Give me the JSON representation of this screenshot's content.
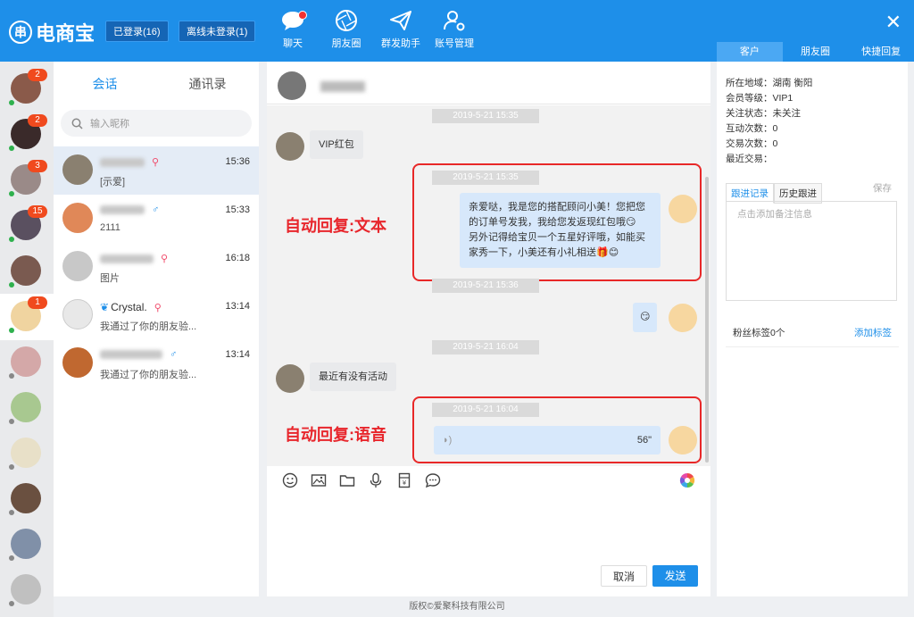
{
  "app": {
    "name": "电商宝"
  },
  "header": {
    "logged_in": "已登录(16)",
    "offline": "离线未登录(1)",
    "nav": [
      {
        "label": "聊天",
        "icon": "chat-icon"
      },
      {
        "label": "朋友圈",
        "icon": "aperture-icon"
      },
      {
        "label": "群发助手",
        "icon": "paper-plane-icon"
      },
      {
        "label": "账号管理",
        "icon": "user-gear-icon"
      }
    ],
    "right_tabs": [
      "客户",
      "朋友圈",
      "快捷回复"
    ],
    "close_symbol": "✕"
  },
  "avatars": [
    {
      "badge": "2",
      "online": "#2fb14e",
      "color": "#8a5a4a"
    },
    {
      "badge": "2",
      "online": "#2fb14e",
      "color": "#3a2a2a"
    },
    {
      "badge": "3",
      "online": "#2fb14e",
      "color": "#9a8a88"
    },
    {
      "badge": "15",
      "online": "#2fb14e",
      "color": "#5a5060"
    },
    {
      "badge": "",
      "online": "#2fb14e",
      "color": "#7a5a50"
    },
    {
      "badge": "1",
      "online": "#2fb14e",
      "color": "#f0d4a0"
    },
    {
      "badge": "",
      "online": "#888888",
      "color": "#d4a8a8"
    },
    {
      "badge": "",
      "online": "#888888",
      "color": "#a8c890"
    },
    {
      "badge": "",
      "online": "#888888",
      "color": "#e8e0c8"
    },
    {
      "badge": "",
      "online": "#888888",
      "color": "#6a5040"
    },
    {
      "badge": "",
      "online": "#888888",
      "color": "#8090a8"
    },
    {
      "badge": "",
      "online": "#888888",
      "color": "#c0c0c0"
    }
  ],
  "conversation": {
    "tabs": [
      "会话",
      "通讯录"
    ],
    "search_placeholder": "输入昵称",
    "items": [
      {
        "time": "15:36",
        "msg": "[示爱]",
        "gender": "⚲",
        "gender_color": "#f04a6a",
        "color": "#8a8070"
      },
      {
        "time": "15:33",
        "msg": "2111",
        "gender": "♂",
        "gender_color": "#1e8fe9",
        "color": "#e08858"
      },
      {
        "time": "16:18",
        "msg": "图片",
        "gender": "⚲",
        "gender_color": "#f04a6a",
        "color": "#c8c8c8"
      },
      {
        "name": "Crystal.",
        "time": "13:14",
        "msg": "我通过了你的朋友验...",
        "gender": "⚲",
        "gender_color": "#f04a6a",
        "color": "#e8e8e8"
      },
      {
        "time": "13:14",
        "msg": "我通过了你的朋友验...",
        "gender": "♂",
        "gender_color": "#1e8fe9",
        "color": "#c06830"
      }
    ]
  },
  "chat": {
    "timestamps": [
      "2019-5-21 15:35",
      "2019-5-21 15:35",
      "2019-5-21 15:36",
      "2019-5-21 16:04",
      "2019-5-21 16:04"
    ],
    "msg_vip": "VIP红包",
    "msg_auto_text_1": "亲爱哒，我是您的搭配顾问小美！您把您",
    "msg_auto_text_2": "的订单号发我，我给您发返现红包哦😏",
    "msg_auto_text_3": "另外记得给宝贝一个五星好评哦，如能买",
    "msg_auto_text_4": "家秀一下，小美还有小礼相送🎁😊",
    "msg_emoji": "😏",
    "msg_activity": "最近有没有活动",
    "voice_duration": "56\"",
    "annot_text": "自动回复:文本",
    "annot_voice": "自动回复:语音",
    "cancel": "取消",
    "send": "发送"
  },
  "customer": {
    "region_label": "所在地域：",
    "region": "湖南 衡阳",
    "level_label": "会员等级：",
    "level": "VIP1",
    "follow_label": "关注状态：",
    "follow": "未关注",
    "interact_label": "互动次数：",
    "interact": "0",
    "trade_label": "交易次数：",
    "trade": "0",
    "last_trade_label": "最近交易：",
    "note_tabs": [
      "跟进记录",
      "历史跟进"
    ],
    "save": "保存",
    "note_placeholder": "点击添加备注信息",
    "fans_tag": "粉丝标签0个",
    "add_tag": "添加标签"
  },
  "footer": "版权©爱聚科技有限公司"
}
